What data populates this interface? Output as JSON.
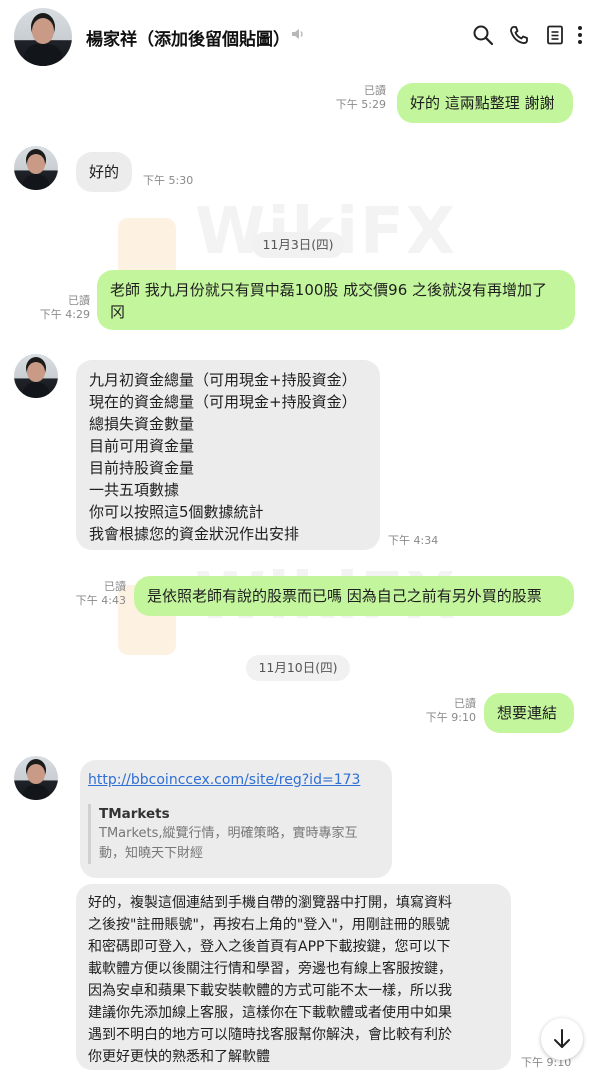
{
  "header": {
    "contact_name": "楊家祥（添加後留個貼圖）",
    "icons": [
      "mute-icon",
      "search-icon",
      "phone-icon",
      "notes-icon",
      "more-icon"
    ]
  },
  "messages": [
    {
      "side": "out",
      "text": "好的 這兩點整理 謝謝",
      "read": "已讀",
      "time": "下午 5:29"
    },
    {
      "side": "in",
      "text": "好的",
      "time": "下午 5:30"
    },
    {
      "date": "11月3日(四)"
    },
    {
      "side": "out",
      "lines": [
        "老師 我九月份就只有買中磊100股 成交價96 之後就沒有再增加了",
        "冈"
      ],
      "read": "已讀",
      "time": "下午 4:29"
    },
    {
      "side": "in",
      "lines": [
        "九月初資金總量（可用現金+持股資金）",
        "現在的資金總量（可用現金+持股資金）",
        "總損失資金數量",
        "目前可用資金量",
        "目前持股資金量",
        "一共五項數據",
        "你可以按照這5個數據統計",
        "我會根據您的資金狀況作出安排"
      ],
      "time": "下午 4:34"
    },
    {
      "side": "out",
      "text": "是依照老師有說的股票而已嗎 因為自己之前有另外買的股票",
      "read": "已讀",
      "time": "下午 4:43"
    },
    {
      "date": "11月10日(四)"
    },
    {
      "side": "out",
      "text": "想要連結",
      "read": "已讀",
      "time": "下午 9:10"
    },
    {
      "side": "in",
      "link": {
        "url": "http://bbcoinccex.com/site/reg?id=173",
        "title": "TMarkets",
        "desc_lines": [
          "TMarkets,縱覽行情，明確策略，實時專家互",
          "動，知曉天下財經"
        ]
      }
    },
    {
      "side": "in",
      "lines": [
        "好的，複製這個連結到手機自帶的瀏覽器中打開，填寫資料",
        "之後按\"註冊賬號\"，再按右上角的\"登入\"，用剛註冊的賬號",
        "和密碼即可登入，登入之後首頁有APP下載按鍵，您可以下",
        "載軟體方便以後關注行情和學習，旁邊也有線上客服按鍵，",
        "因為安卓和蘋果下載安裝軟體的方式可能不太一樣，所以我",
        "建議你先添加線上客服，這樣你在下載軟體或者使用中如果",
        "遇到不明白的地方可以隨時找客服幫你解決，會比較有利於",
        "你更好更快的熟悉和了解軟體"
      ],
      "time": "下午 9:10"
    }
  ],
  "watermark": "WikiFX",
  "colors": {
    "outgoing_bubble": "#c3f69c",
    "incoming_bubble": "#ececec",
    "link": "#2f6fd6"
  }
}
